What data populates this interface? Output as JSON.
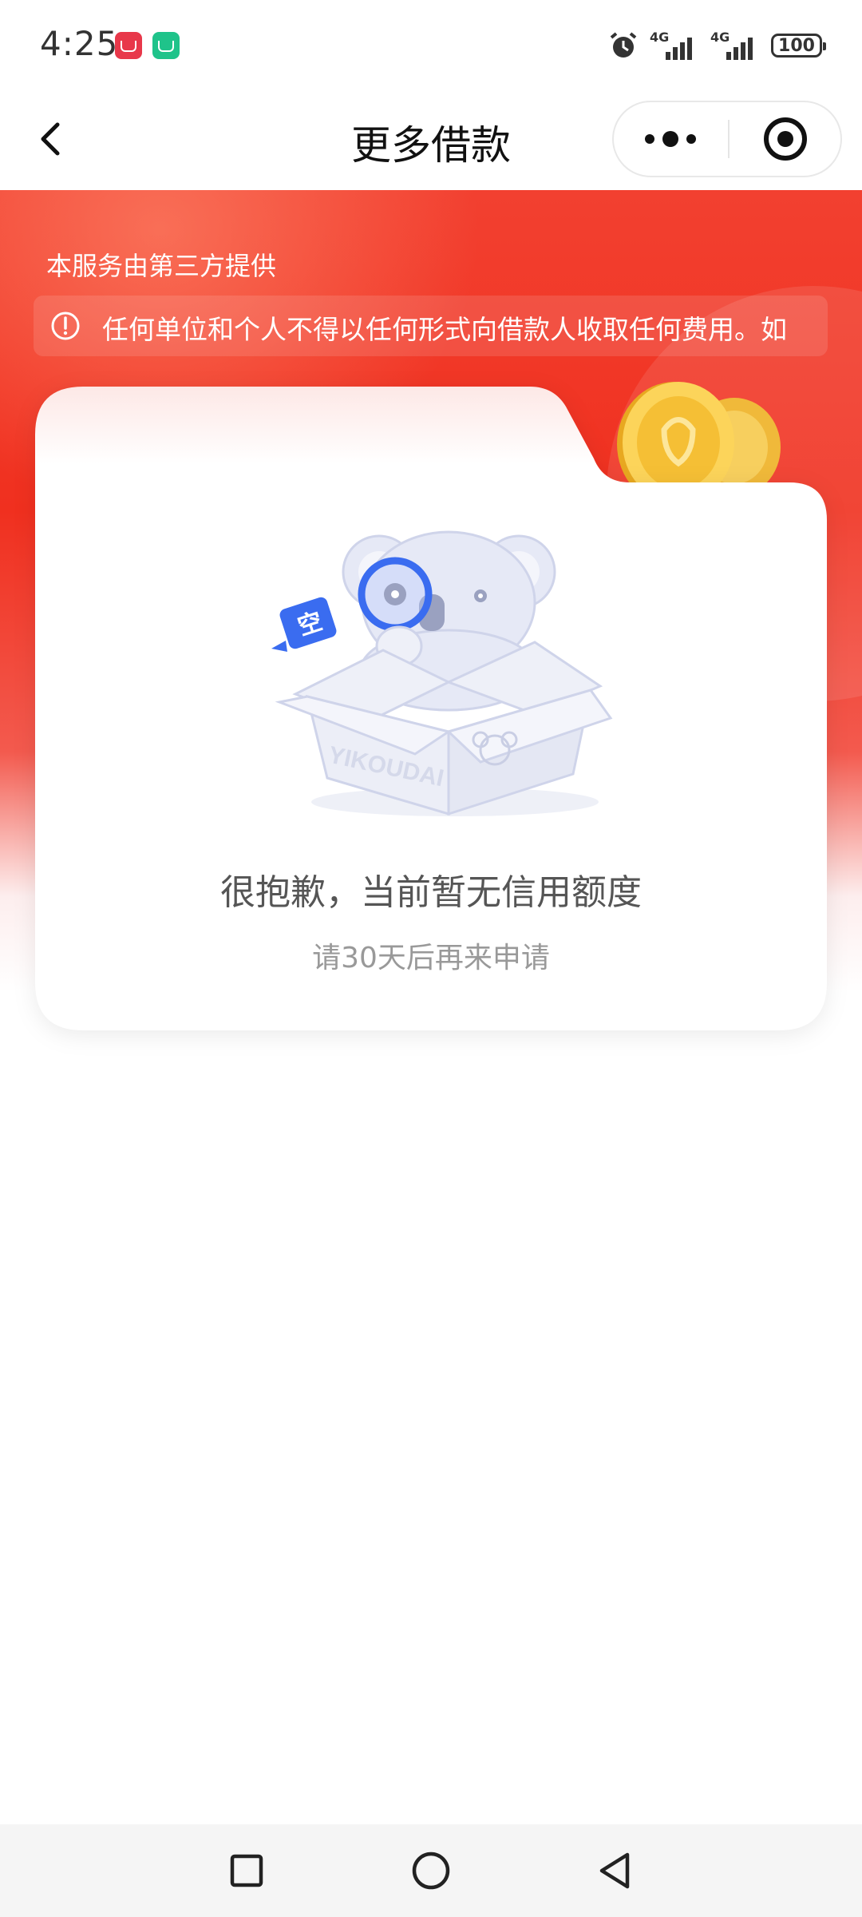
{
  "status_bar": {
    "time": "4:25",
    "network_1": "4G",
    "network_2": "4G",
    "battery": "100"
  },
  "nav": {
    "title": "更多借款"
  },
  "hero": {
    "provider_text": "本服务由第三方提供",
    "notice_text": "任何单位和个人不得以任何形式向借款人收取任何费用。如"
  },
  "empty_state": {
    "badge_char": "空",
    "box_brand": "YIKOUDAI",
    "title": "很抱歉，当前暂无信用额度",
    "subtitle": "请30天后再来申请"
  },
  "colors": {
    "hero_red": "#f0301f",
    "illustration_blue": "#3a6cf0",
    "illustration_light": "#e6e9f6"
  }
}
